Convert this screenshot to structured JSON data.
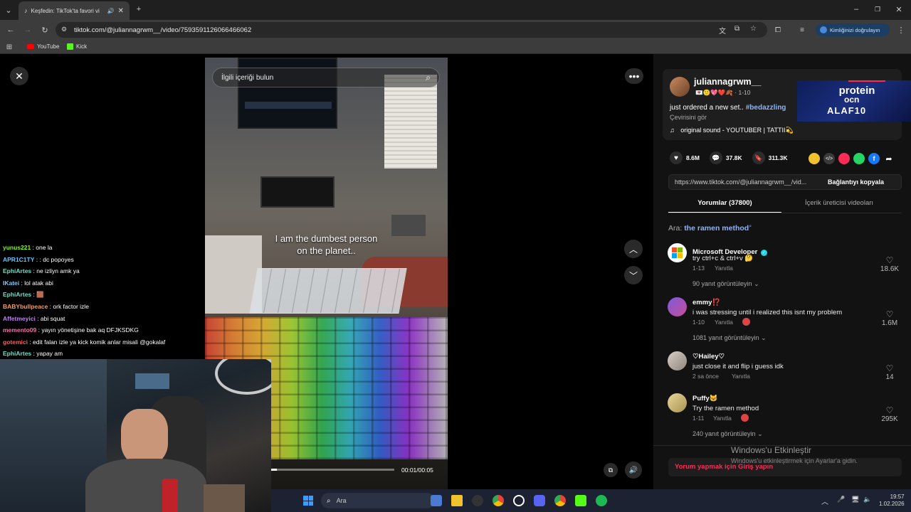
{
  "browser": {
    "tab_title": "Keşfedin: TikTok'ta favori vi",
    "url": "tiktok.com/@juliannagrwm__/video/7593591126066466062",
    "signin_label": "Kimliğinizi doğrulayın",
    "bookmarks": [
      {
        "label": "YouTube",
        "color": "#ff0000"
      },
      {
        "label": "Kick",
        "color": "#53fc18"
      }
    ]
  },
  "search": {
    "placeholder": "İlgili içeriği bulun"
  },
  "video": {
    "caption_line1": "I am the dumbest person",
    "caption_line2": "on the planet..",
    "time": "00:01/00:05",
    "progress": 0.05
  },
  "author": {
    "username": "juliannagrwm__",
    "meta": "💌🙂💖❤️🍂 · 1-10",
    "desc_text": "just ordered a new set.. ",
    "desc_tag": "#bedazzling",
    "translate": "Çevirisini gör",
    "sound": "original sound - YOUTUBER | TATTII💫"
  },
  "ad": {
    "line1": "protein",
    "line2": "ocn",
    "line3": "ALAF10"
  },
  "stats": {
    "likes": "8.6M",
    "comments": "37.8K",
    "saves": "311.3K"
  },
  "share": {
    "link": "https://www.tiktok.com/@juliannagrwm__/vid...",
    "copy_label": "Bağlantıyı kopyala"
  },
  "tabs": {
    "comments": "Yorumlar (37800)",
    "creator_videos": "İçerik üreticisi videoları"
  },
  "search_suggest": {
    "prefix": "Ara:",
    "query": "the ramen method"
  },
  "comments": [
    {
      "name": "Microsoft Developer",
      "text": "try ctrl+c & ctrl+v 🤔",
      "date": "1-13",
      "reply": "Yanıtla",
      "likes": "18.6K",
      "replies": "90 yanıt görüntüleyin"
    },
    {
      "name": "emmy⁉️",
      "text": "i was stressing until i realized this isnt my problem",
      "date": "1-10",
      "reply": "Yanıtla",
      "likes": "1.6M",
      "replies": "1081 yanıt görüntüleyin"
    },
    {
      "name": "♡Hailey♡",
      "text": "just close it and flip i guess idk",
      "date": "2 sa önce",
      "reply": "Yanıtla",
      "likes": "14",
      "replies": ""
    },
    {
      "name": "Puffy🐱",
      "text": "Try the ramen method",
      "date": "1-11",
      "reply": "Yanıtla",
      "likes": "295K",
      "replies": "240 yanıt görüntüleyin"
    }
  ],
  "login_prompt": "Yorum yapmak için Giriş yapın",
  "windows_activate": {
    "title": "Windows'u Etkinleştir",
    "subtitle": "Windows'u etkinleştirmek için Ayarlar'a gidin."
  },
  "chat": [
    {
      "user": "yunus221",
      "color": "#7cfc00",
      "msg": ": one la"
    },
    {
      "user": "APR1C1TY",
      "color": "#5cc8ff",
      "msg": ": : dc popoyes"
    },
    {
      "user": "EphiArtes",
      "color": "#6fe0c6",
      "msg": ": ne izliyn amk ya"
    },
    {
      "user": "IKatei",
      "color": "#7ec8ff",
      "msg": ": lol atak abi"
    },
    {
      "user": "EphiArtes",
      "color": "#6fe0c6",
      "msg": ": 🟫"
    },
    {
      "user": "BABYbullpeace",
      "color": "#ff9a5c",
      "msg": ": ork factor izle"
    },
    {
      "user": "Affetmeyici",
      "color": "#c77dff",
      "msg": ": abi squat"
    },
    {
      "user": "memento09",
      "color": "#ff6fb0",
      "msg": ": yayın yönetişine bak aq DFJKSDKG"
    },
    {
      "user": "gotemici",
      "color": "#ff5c5c",
      "msg": ": edit falan izle ya kick komik anlar misali @gokalaf"
    },
    {
      "user": "EphiArtes",
      "color": "#6fe0c6",
      "msg": ": yapay am"
    }
  ],
  "taskbar": {
    "search": "Ara",
    "time": "19:57",
    "date": "1.02.2026"
  }
}
